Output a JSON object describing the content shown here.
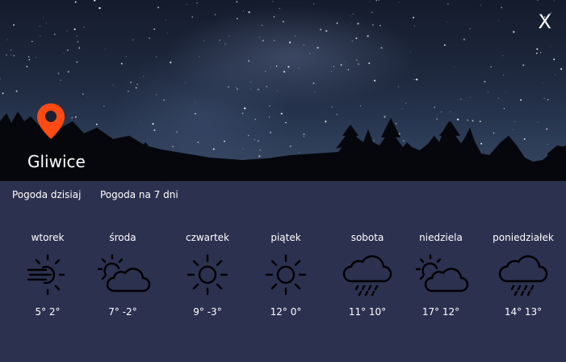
{
  "header": {
    "city": "Gliwice",
    "close_label": "X",
    "accent_color": "#ff4a14"
  },
  "tabs": [
    {
      "label": "Pogoda dzisiaj"
    },
    {
      "label": "Pogoda na 7 dni"
    }
  ],
  "forecast": [
    {
      "day": "wtorek",
      "icon": "wind-sun-icon",
      "temp": "5° 2°"
    },
    {
      "day": "środa",
      "icon": "sun-cloud-icon",
      "temp": "7° -2°"
    },
    {
      "day": "czwartek",
      "icon": "sun-icon",
      "temp": "9° -3°"
    },
    {
      "day": "piątek",
      "icon": "sun-icon",
      "temp": "12° 0°"
    },
    {
      "day": "sobota",
      "icon": "rain-cloud-icon",
      "temp": "11° 10°"
    },
    {
      "day": "niedziela",
      "icon": "sun-cloud-icon",
      "temp": "17° 12°"
    },
    {
      "day": "poniedziałek",
      "icon": "rain-cloud-icon",
      "temp": "14° 13°"
    }
  ],
  "colors": {
    "panel_bg": "#2d3150",
    "text": "#ffffff",
    "icon_stroke": "#000000"
  }
}
